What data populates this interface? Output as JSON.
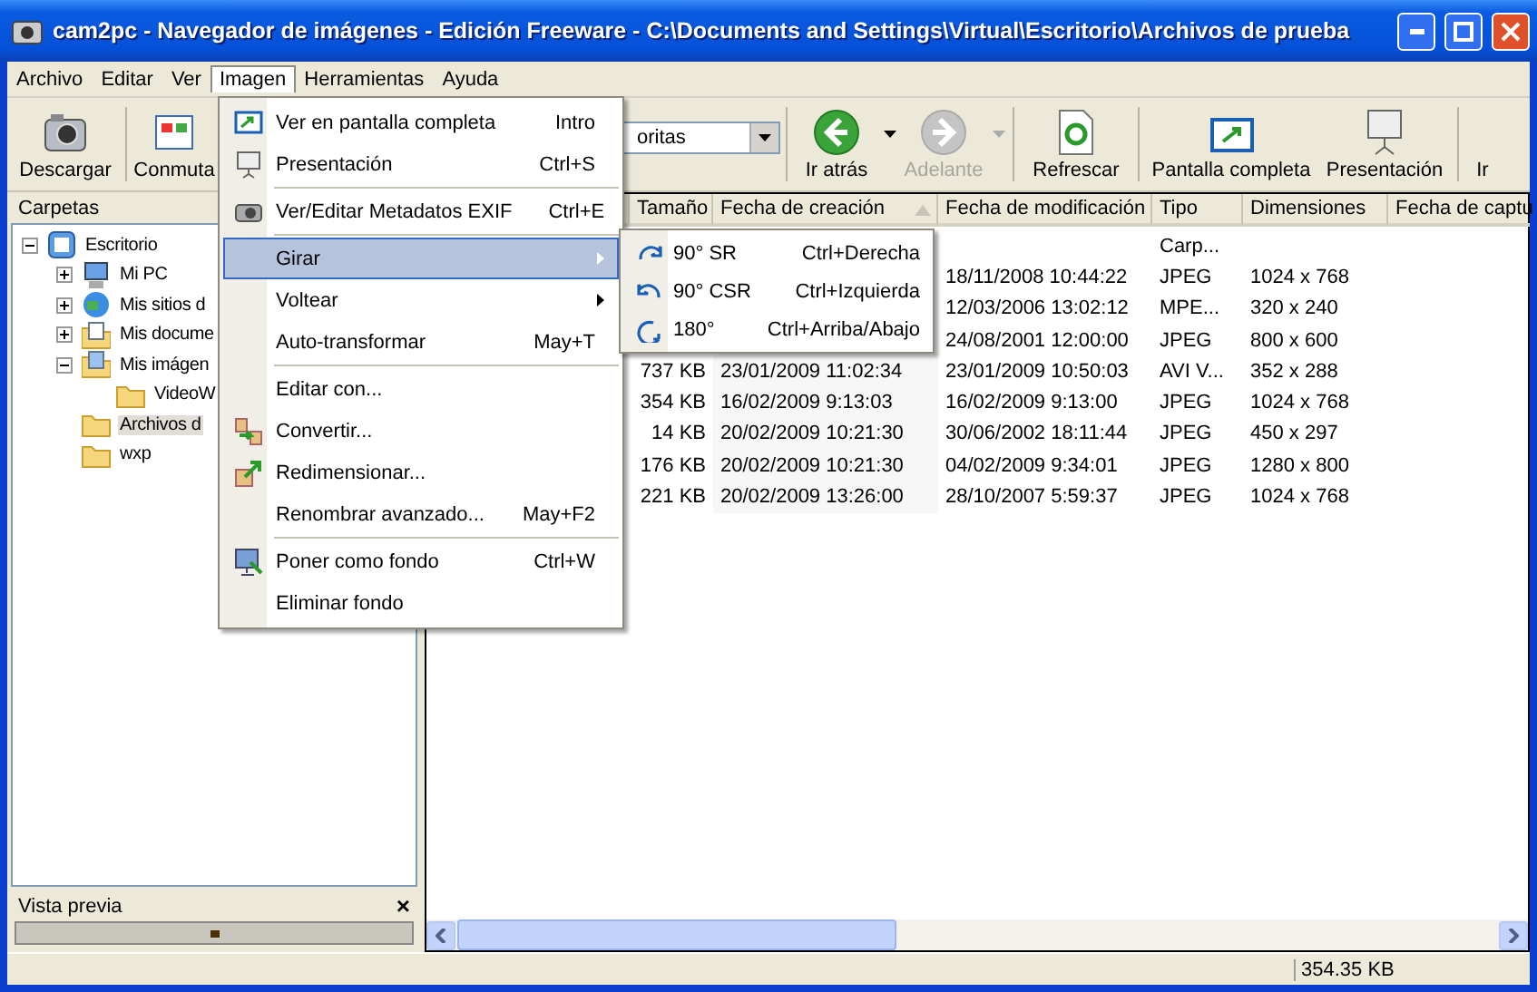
{
  "window": {
    "title": "cam2pc - Navegador de imágenes - Edición Freeware - C:\\Documents and Settings\\Virtual\\Escritorio\\Archivos de prueba"
  },
  "menu_bar": [
    {
      "label": "Archivo",
      "selected": false
    },
    {
      "label": "Editar",
      "selected": false
    },
    {
      "label": "Ver",
      "selected": false
    },
    {
      "label": "Imagen",
      "selected": true
    },
    {
      "label": "Herramientas",
      "selected": false
    },
    {
      "label": "Ayuda",
      "selected": false
    }
  ],
  "toolbar": [
    {
      "kind": "button",
      "label": "Descargar",
      "disabled": false
    },
    {
      "kind": "separator"
    },
    {
      "kind": "button",
      "label": "Conmuta",
      "disabled": false
    },
    {
      "kind": "combo",
      "value": "oritas"
    },
    {
      "kind": "separator"
    },
    {
      "kind": "button",
      "label": "Ir atrás",
      "disabled": false,
      "dropdown": true
    },
    {
      "kind": "button",
      "label": "Adelante",
      "disabled": true,
      "dropdown": true
    },
    {
      "kind": "separator"
    },
    {
      "kind": "button",
      "label": "Refrescar",
      "disabled": false
    },
    {
      "kind": "separator"
    },
    {
      "kind": "button",
      "label": "Pantalla completa",
      "disabled": false
    },
    {
      "kind": "button",
      "label": "Presentación",
      "disabled": false
    },
    {
      "kind": "separator"
    },
    {
      "kind": "button",
      "label": "Ir",
      "disabled": false
    }
  ],
  "folders": {
    "title": "Carpetas",
    "tree": [
      {
        "label": "Escritorio",
        "expanded": true,
        "selected": false,
        "children": [
          {
            "label": "Mi PC",
            "expanded": false,
            "selected": false
          },
          {
            "label": "Mis sitios d",
            "expanded": false,
            "selected": false
          },
          {
            "label": "Mis docume",
            "expanded": false,
            "selected": false
          },
          {
            "label": "Mis imágen",
            "expanded": true,
            "selected": false,
            "children": [
              {
                "label": "VideoW",
                "selected": false
              }
            ]
          },
          {
            "label": "Archivos d",
            "selected": true
          },
          {
            "label": "wxp",
            "selected": false
          }
        ]
      }
    ]
  },
  "preview": {
    "title": "Vista previa",
    "close": "×"
  },
  "file_list": {
    "columns": [
      {
        "label": "Tamaño",
        "sorted": false
      },
      {
        "label": "Fecha de creación",
        "sorted": true
      },
      {
        "label": "Fecha de modificación",
        "sorted": false
      },
      {
        "label": "Tipo",
        "sorted": false
      },
      {
        "label": "Dimensiones",
        "sorted": false
      },
      {
        "label": "Fecha de captu",
        "sorted": false
      }
    ],
    "rows": [
      {
        "type": "Carp..."
      },
      {
        "modified": "18/11/2008 10:44:22",
        "type": "JPEG",
        "dimensions": "1024 x 768"
      },
      {
        "modified": "12/03/2006 13:02:12",
        "type": "MPE...",
        "dimensions": "320 x 240"
      },
      {
        "modified": "24/08/2001 12:00:00",
        "type": "JPEG",
        "dimensions": "800 x 600"
      },
      {
        "size": "737 KB",
        "created": "23/01/2009 11:02:34",
        "modified": "23/01/2009 10:50:03",
        "type": "AVI V...",
        "dimensions": "352 x 288"
      },
      {
        "size": "354 KB",
        "created": "16/02/2009 9:13:03",
        "modified": "16/02/2009 9:13:00",
        "type": "JPEG",
        "dimensions": "1024 x 768"
      },
      {
        "size": "14 KB",
        "created": "20/02/2009 10:21:30",
        "modified": "30/06/2002 18:11:44",
        "type": "JPEG",
        "dimensions": "450 x 297"
      },
      {
        "size": "176 KB",
        "created": "20/02/2009 10:21:30",
        "modified": "04/02/2009 9:34:01",
        "type": "JPEG",
        "dimensions": "1280 x 800"
      },
      {
        "size": "221 KB",
        "created": "20/02/2009 13:26:00",
        "modified": "28/10/2007 5:59:37",
        "type": "JPEG",
        "dimensions": "1024 x 768"
      }
    ]
  },
  "image_menu": [
    {
      "kind": "item",
      "label": "Ver en pantalla completa",
      "shortcut": "Intro",
      "selected": false
    },
    {
      "kind": "item",
      "label": "Presentación",
      "shortcut": "Ctrl+S",
      "selected": false
    },
    {
      "kind": "separator"
    },
    {
      "kind": "item",
      "label": "Ver/Editar Metadatos EXIF",
      "shortcut": "Ctrl+E",
      "selected": false
    },
    {
      "kind": "separator"
    },
    {
      "kind": "submenu",
      "label": "Girar",
      "selected": true
    },
    {
      "kind": "submenu",
      "label": "Voltear",
      "selected": false
    },
    {
      "kind": "item",
      "label": "Auto-transformar",
      "shortcut": "May+T",
      "selected": false
    },
    {
      "kind": "separator"
    },
    {
      "kind": "item",
      "label": "Editar con...",
      "selected": false
    },
    {
      "kind": "item",
      "label": "Convertir...",
      "selected": false
    },
    {
      "kind": "item",
      "label": "Redimensionar...",
      "selected": false
    },
    {
      "kind": "item",
      "label": "Renombrar avanzado...",
      "shortcut": "May+F2",
      "selected": false
    },
    {
      "kind": "separator"
    },
    {
      "kind": "item",
      "label": "Poner como fondo",
      "shortcut": "Ctrl+W",
      "selected": false
    },
    {
      "kind": "item",
      "label": "Eliminar fondo",
      "selected": false
    }
  ],
  "rotate_submenu": [
    {
      "label": "90° SR",
      "shortcut": "Ctrl+Derecha",
      "selected": false
    },
    {
      "label": "90° CSR",
      "shortcut": "Ctrl+Izquierda",
      "selected": false
    },
    {
      "label": "180°",
      "shortcut": "Ctrl+Arriba/Abajo",
      "selected": false
    }
  ],
  "status_bar": {
    "size": "354.35 KB"
  }
}
